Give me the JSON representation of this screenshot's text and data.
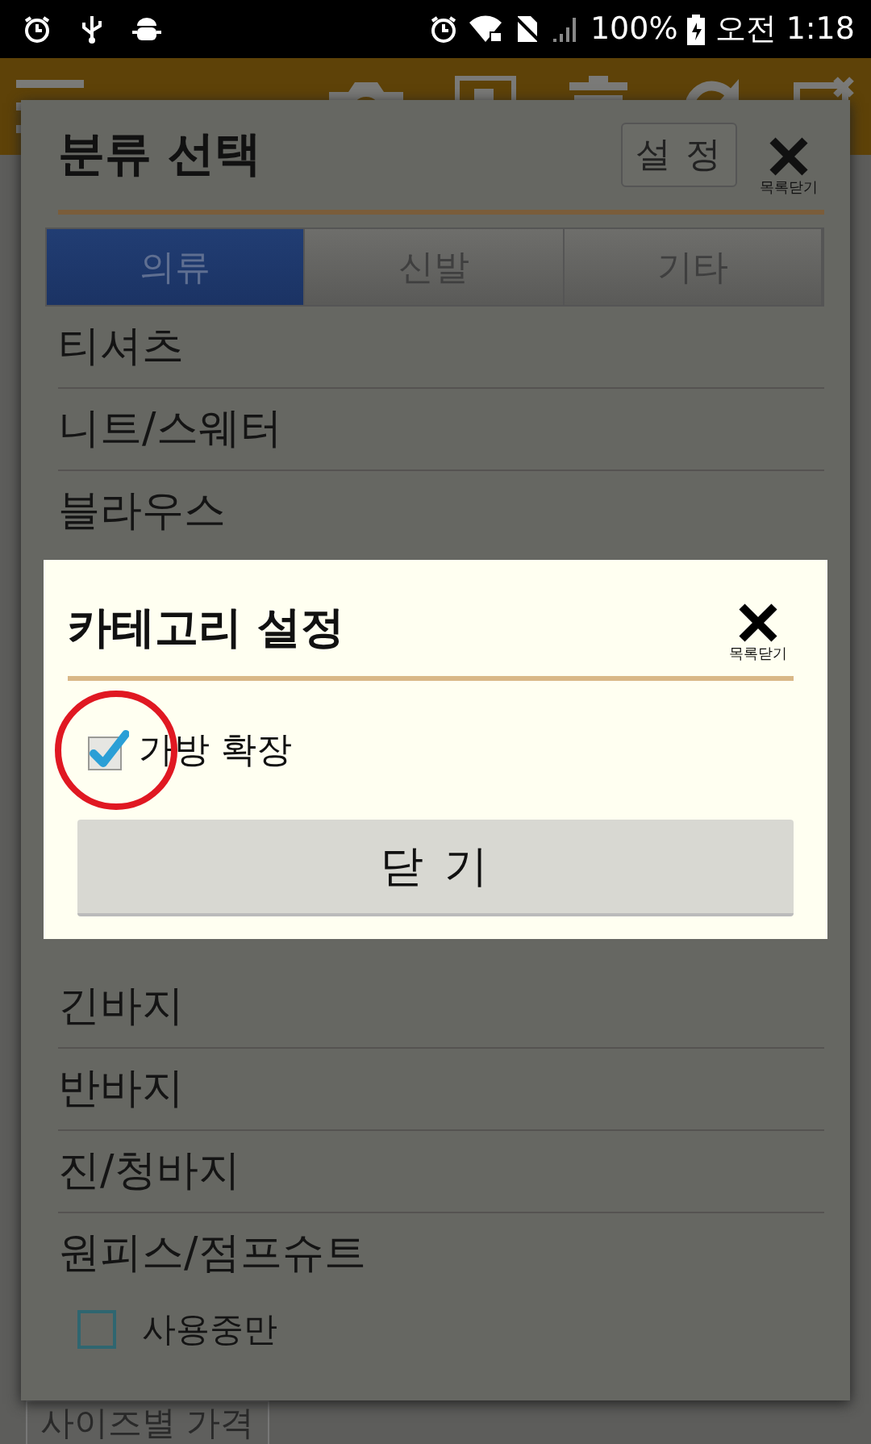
{
  "status_bar": {
    "battery_percent": "100%",
    "time": "오전 1:18"
  },
  "background": {
    "size_price_button": "사이즈별 가격"
  },
  "category_dialog": {
    "title": "분류 선택",
    "settings_button": "설 정",
    "close_label": "목록닫기",
    "tabs": [
      {
        "label": "의류",
        "selected": true
      },
      {
        "label": "신발",
        "selected": false
      },
      {
        "label": "기타",
        "selected": false
      }
    ],
    "items": [
      "티셔츠",
      "니트/스웨터",
      "블라우스",
      "긴바지",
      "반바지",
      "진/청바지",
      "원피스/점프슈트"
    ],
    "in_use_only": {
      "label": "사용중만",
      "checked": false
    }
  },
  "settings_dialog": {
    "title": "카테고리 설정",
    "close_label": "목록닫기",
    "options": [
      {
        "label": "가방 확장",
        "checked": true,
        "highlighted": true
      }
    ],
    "close_button": "닫 기"
  }
}
